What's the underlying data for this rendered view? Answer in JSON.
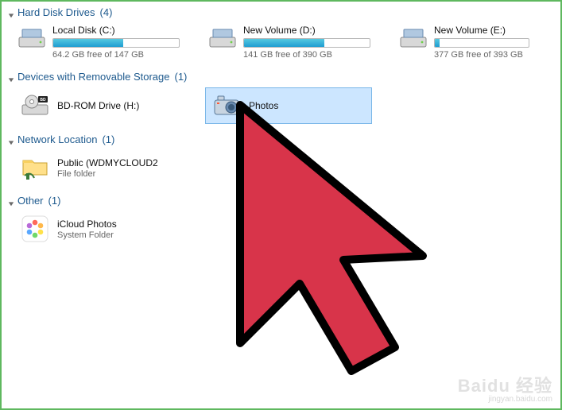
{
  "groups": {
    "hdd": {
      "title": "Hard Disk Drives",
      "count": "(4)"
    },
    "removable": {
      "title": "Devices with Removable Storage",
      "count": "(1)"
    },
    "network": {
      "title": "Network Location",
      "count": "(1)"
    },
    "other": {
      "title": "Other",
      "count": "(1)"
    }
  },
  "drives": [
    {
      "name": "Local Disk (C:)",
      "free": "64.2 GB free of 147 GB",
      "used_pct": 56
    },
    {
      "name": "New Volume (D:)",
      "free": "141 GB free of 390 GB",
      "used_pct": 64
    },
    {
      "name": "New Volume (E:)",
      "free": "377 GB free of 393 GB",
      "used_pct": 5
    }
  ],
  "removable_items": [
    {
      "name": "BD-ROM Drive (H:)",
      "sub": ""
    },
    {
      "name": "Photos",
      "sub": "",
      "selected": true
    }
  ],
  "network_items": [
    {
      "name": "Public (WDMYCLOUD2",
      "sub": "File folder"
    }
  ],
  "other_items": [
    {
      "name": "iCloud Photos",
      "sub": "System Folder"
    }
  ],
  "watermark": {
    "brand": "Baidu 经验",
    "url": "jingyan.baidu.com"
  }
}
